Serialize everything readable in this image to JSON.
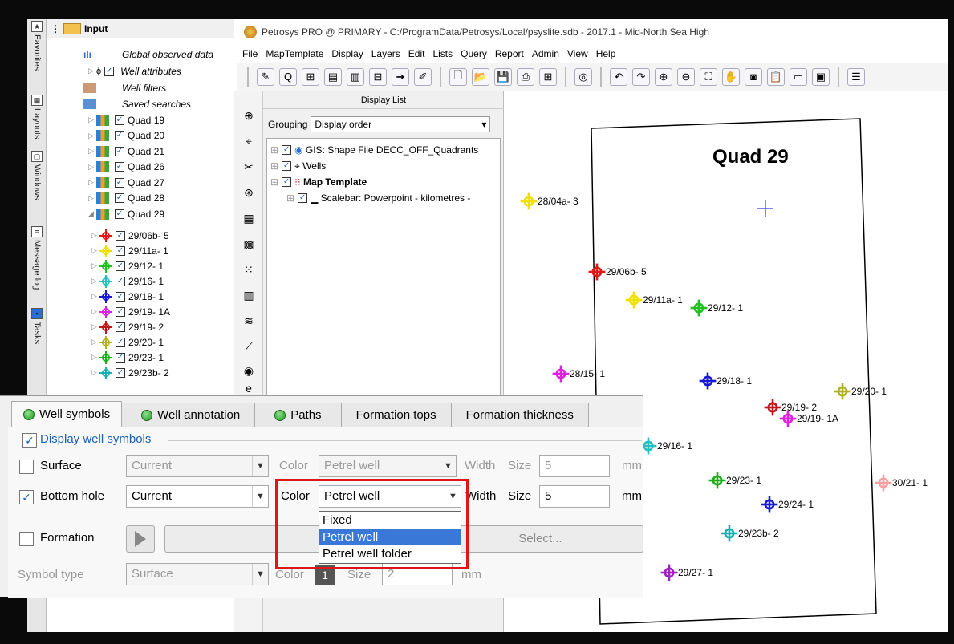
{
  "window_title": "Petrosys PRO @ PRIMARY - C:/ProgramData/Petrosys/Local/psyslite.sdb - 2017.1 - Mid-North Sea High",
  "side_tabs": [
    "Favorites",
    "Layouts",
    "Windows",
    "Message log",
    "Tasks"
  ],
  "tree": {
    "header": "Input",
    "items": [
      {
        "label": "Global observed data"
      },
      {
        "label": "Well attributes"
      },
      {
        "label": "Well filters"
      },
      {
        "label": "Saved searches"
      },
      {
        "label": "Quad 19"
      },
      {
        "label": "Quad 20"
      },
      {
        "label": "Quad 21"
      },
      {
        "label": "Quad 26"
      },
      {
        "label": "Quad 27"
      },
      {
        "label": "Quad 28"
      },
      {
        "label": "Quad 29"
      }
    ],
    "wells": [
      {
        "label": "29/06b- 5",
        "color": "#e01818"
      },
      {
        "label": "29/11a- 1",
        "color": "#f0e000"
      },
      {
        "label": "29/12- 1",
        "color": "#22c022"
      },
      {
        "label": "29/16- 1",
        "color": "#22c0c0"
      },
      {
        "label": "29/18- 1",
        "color": "#1818d8"
      },
      {
        "label": "29/19- 1A",
        "color": "#e020e0"
      },
      {
        "label": "29/19- 2",
        "color": "#c01818"
      },
      {
        "label": "29/20- 1",
        "color": "#b0b020"
      },
      {
        "label": "29/23- 1",
        "color": "#18b018"
      },
      {
        "label": "29/23b- 2",
        "color": "#18b0b0"
      }
    ]
  },
  "menu": [
    "File",
    "MapTemplate",
    "Display",
    "Layers",
    "Edit",
    "Lists",
    "Query",
    "Report",
    "Admin",
    "View",
    "Help"
  ],
  "display_list": {
    "title": "Display List",
    "grouping_label": "Grouping",
    "grouping_value": "Display order",
    "items": [
      "GIS: Shape File DECC_OFF_Quadrants",
      "Wells",
      "Map Template",
      "Scalebar: Powerpoint - kilometres -"
    ]
  },
  "map": {
    "title": "Quad  29",
    "wells": [
      {
        "label": "28/04a- 3",
        "color": "#f0e000"
      },
      {
        "label": "29/06b- 5",
        "color": "#e01818"
      },
      {
        "label": "29/11a- 1",
        "color": "#f0e000"
      },
      {
        "label": "29/12- 1",
        "color": "#22c022"
      },
      {
        "label": "28/15- 1",
        "color": "#e020e0"
      },
      {
        "label": "29/18- 1",
        "color": "#1818d8"
      },
      {
        "label": "29/20- 1",
        "color": "#b0b020"
      },
      {
        "label": "29/19- 2",
        "color": "#c01818"
      },
      {
        "label": "29/19- 1A",
        "color": "#e020e0"
      },
      {
        "label": "29/16- 1",
        "color": "#22c0c0"
      },
      {
        "label": "29/23- 1",
        "color": "#18b018"
      },
      {
        "label": "30/21- 1",
        "color": "#f4a0a0"
      },
      {
        "label": "29/24- 1",
        "color": "#1818d8"
      },
      {
        "label": "29/23b- 2",
        "color": "#18b0b0"
      },
      {
        "label": "29/27- 1",
        "color": "#a020c0"
      }
    ]
  },
  "dialog": {
    "tabs": [
      "Well symbols",
      "Well annotation",
      "Paths",
      "Formation tops",
      "Formation thickness"
    ],
    "display_well_symbols": "Display well symbols",
    "surface": {
      "label": "Surface",
      "value": "Current",
      "color_label": "Color",
      "color_value": "Petrel well",
      "width_label": "Width",
      "size_label": "Size",
      "size_value": "5",
      "unit": "mm"
    },
    "bottom_hole": {
      "label": "Bottom hole",
      "value": "Current",
      "color_label": "Color",
      "color_value": "Petrel well",
      "width_label": "Width",
      "size_label": "Size",
      "size_value": "5",
      "unit": "mm"
    },
    "formation": {
      "label": "Formation",
      "select_label": "Select..."
    },
    "symbol_type": {
      "label": "Symbol type",
      "value": "Surface",
      "color_label": "Color",
      "color_value": "1",
      "size_label": "Size",
      "size_value": "2",
      "unit": "mm"
    },
    "dropdown_options": [
      "Fixed",
      "Petrel well",
      "Petrel well folder"
    ],
    "dropdown_selected": "Petrel well"
  }
}
